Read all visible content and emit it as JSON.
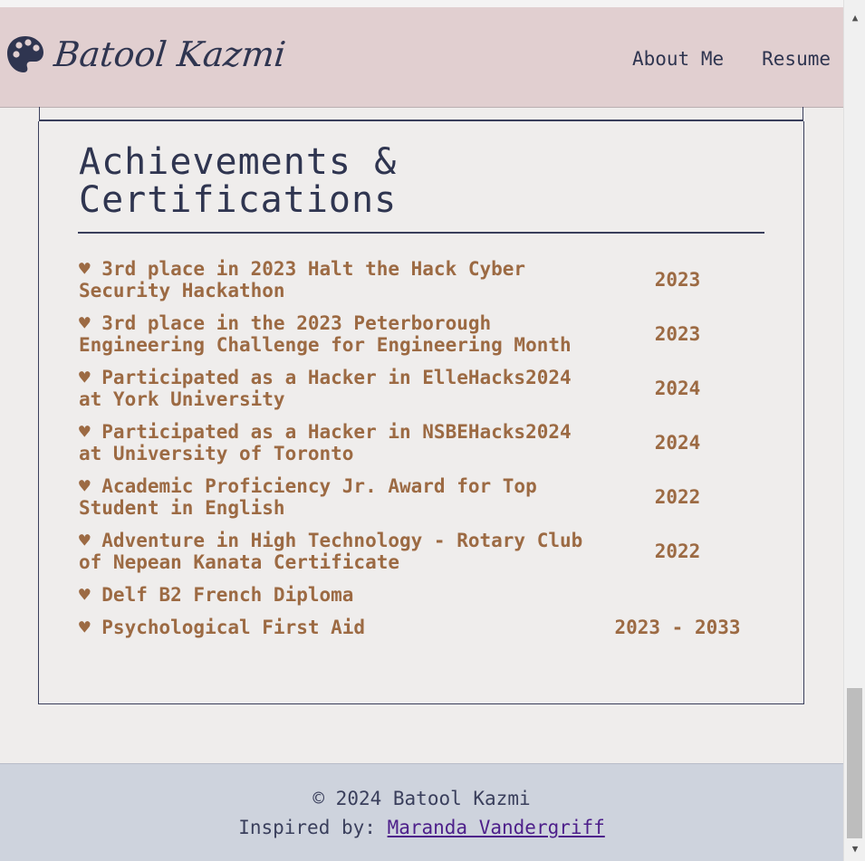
{
  "header": {
    "brand": "Batool Kazmi",
    "nav": [
      "About Me",
      "Resume"
    ]
  },
  "section": {
    "title": "Achievements & Certifications"
  },
  "achievements": [
    {
      "text": "♥ 3rd place in 2023 Halt the Hack Cyber Security Hackathon",
      "year": "2023"
    },
    {
      "text": "♥ 3rd place in the 2023 Peterborough Engineering Challenge for Engineering Month",
      "year": "2023"
    },
    {
      "text": "♥ Participated as a Hacker in ElleHacks2024 at York University",
      "year": "2024"
    },
    {
      "text": "♥ Participated as a Hacker in NSBEHacks2024 at University of Toronto",
      "year": "2024"
    },
    {
      "text": "♥ Academic Proficiency Jr. Award for Top Student in English",
      "year": "2022"
    },
    {
      "text": "♥ Adventure in High Technology - Rotary Club of Nepean Kanata Certificate",
      "year": "2022"
    },
    {
      "text": "♥ Delf B2 French Diploma",
      "year": ""
    },
    {
      "text": "♥ Psychological First Aid",
      "year": "2023 - 2033"
    }
  ],
  "footer": {
    "copyright": "© 2024 Batool Kazmi",
    "inspired_prefix": "Inspired by: ",
    "inspired_link": "Maranda Vandergriff"
  },
  "scrollbar": {
    "up_glyph": "▲",
    "down_glyph": "▼"
  },
  "colors": {
    "header_bg": "#e1cfd0",
    "page_bg": "#efedec",
    "accent_text": "#9c6a43",
    "navy": "#2f3550",
    "footer_bg": "#ced3dd"
  }
}
